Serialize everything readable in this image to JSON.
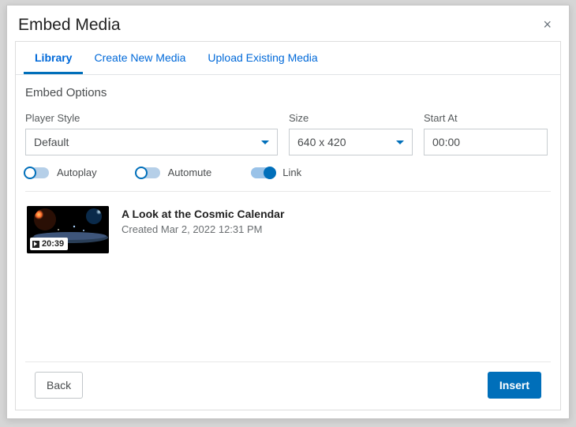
{
  "dialog": {
    "title": "Embed Media",
    "close_glyph": "×"
  },
  "tabs": [
    {
      "label": "Library",
      "active": true
    },
    {
      "label": "Create New Media",
      "active": false
    },
    {
      "label": "Upload Existing Media",
      "active": false
    }
  ],
  "section_title": "Embed Options",
  "fields": {
    "player_style": {
      "label": "Player Style",
      "value": "Default"
    },
    "size": {
      "label": "Size",
      "value": "640 x 420"
    },
    "start_at": {
      "label": "Start At",
      "value": "00:00"
    }
  },
  "toggles": {
    "autoplay": {
      "label": "Autoplay",
      "on": false
    },
    "automute": {
      "label": "Automute",
      "on": false
    },
    "link": {
      "label": "Link",
      "on": true
    }
  },
  "media": {
    "title": "A Look at the Cosmic Calendar",
    "created": "Created Mar 2, 2022 12:31 PM",
    "duration": "20:39"
  },
  "footer": {
    "back": "Back",
    "insert": "Insert"
  }
}
